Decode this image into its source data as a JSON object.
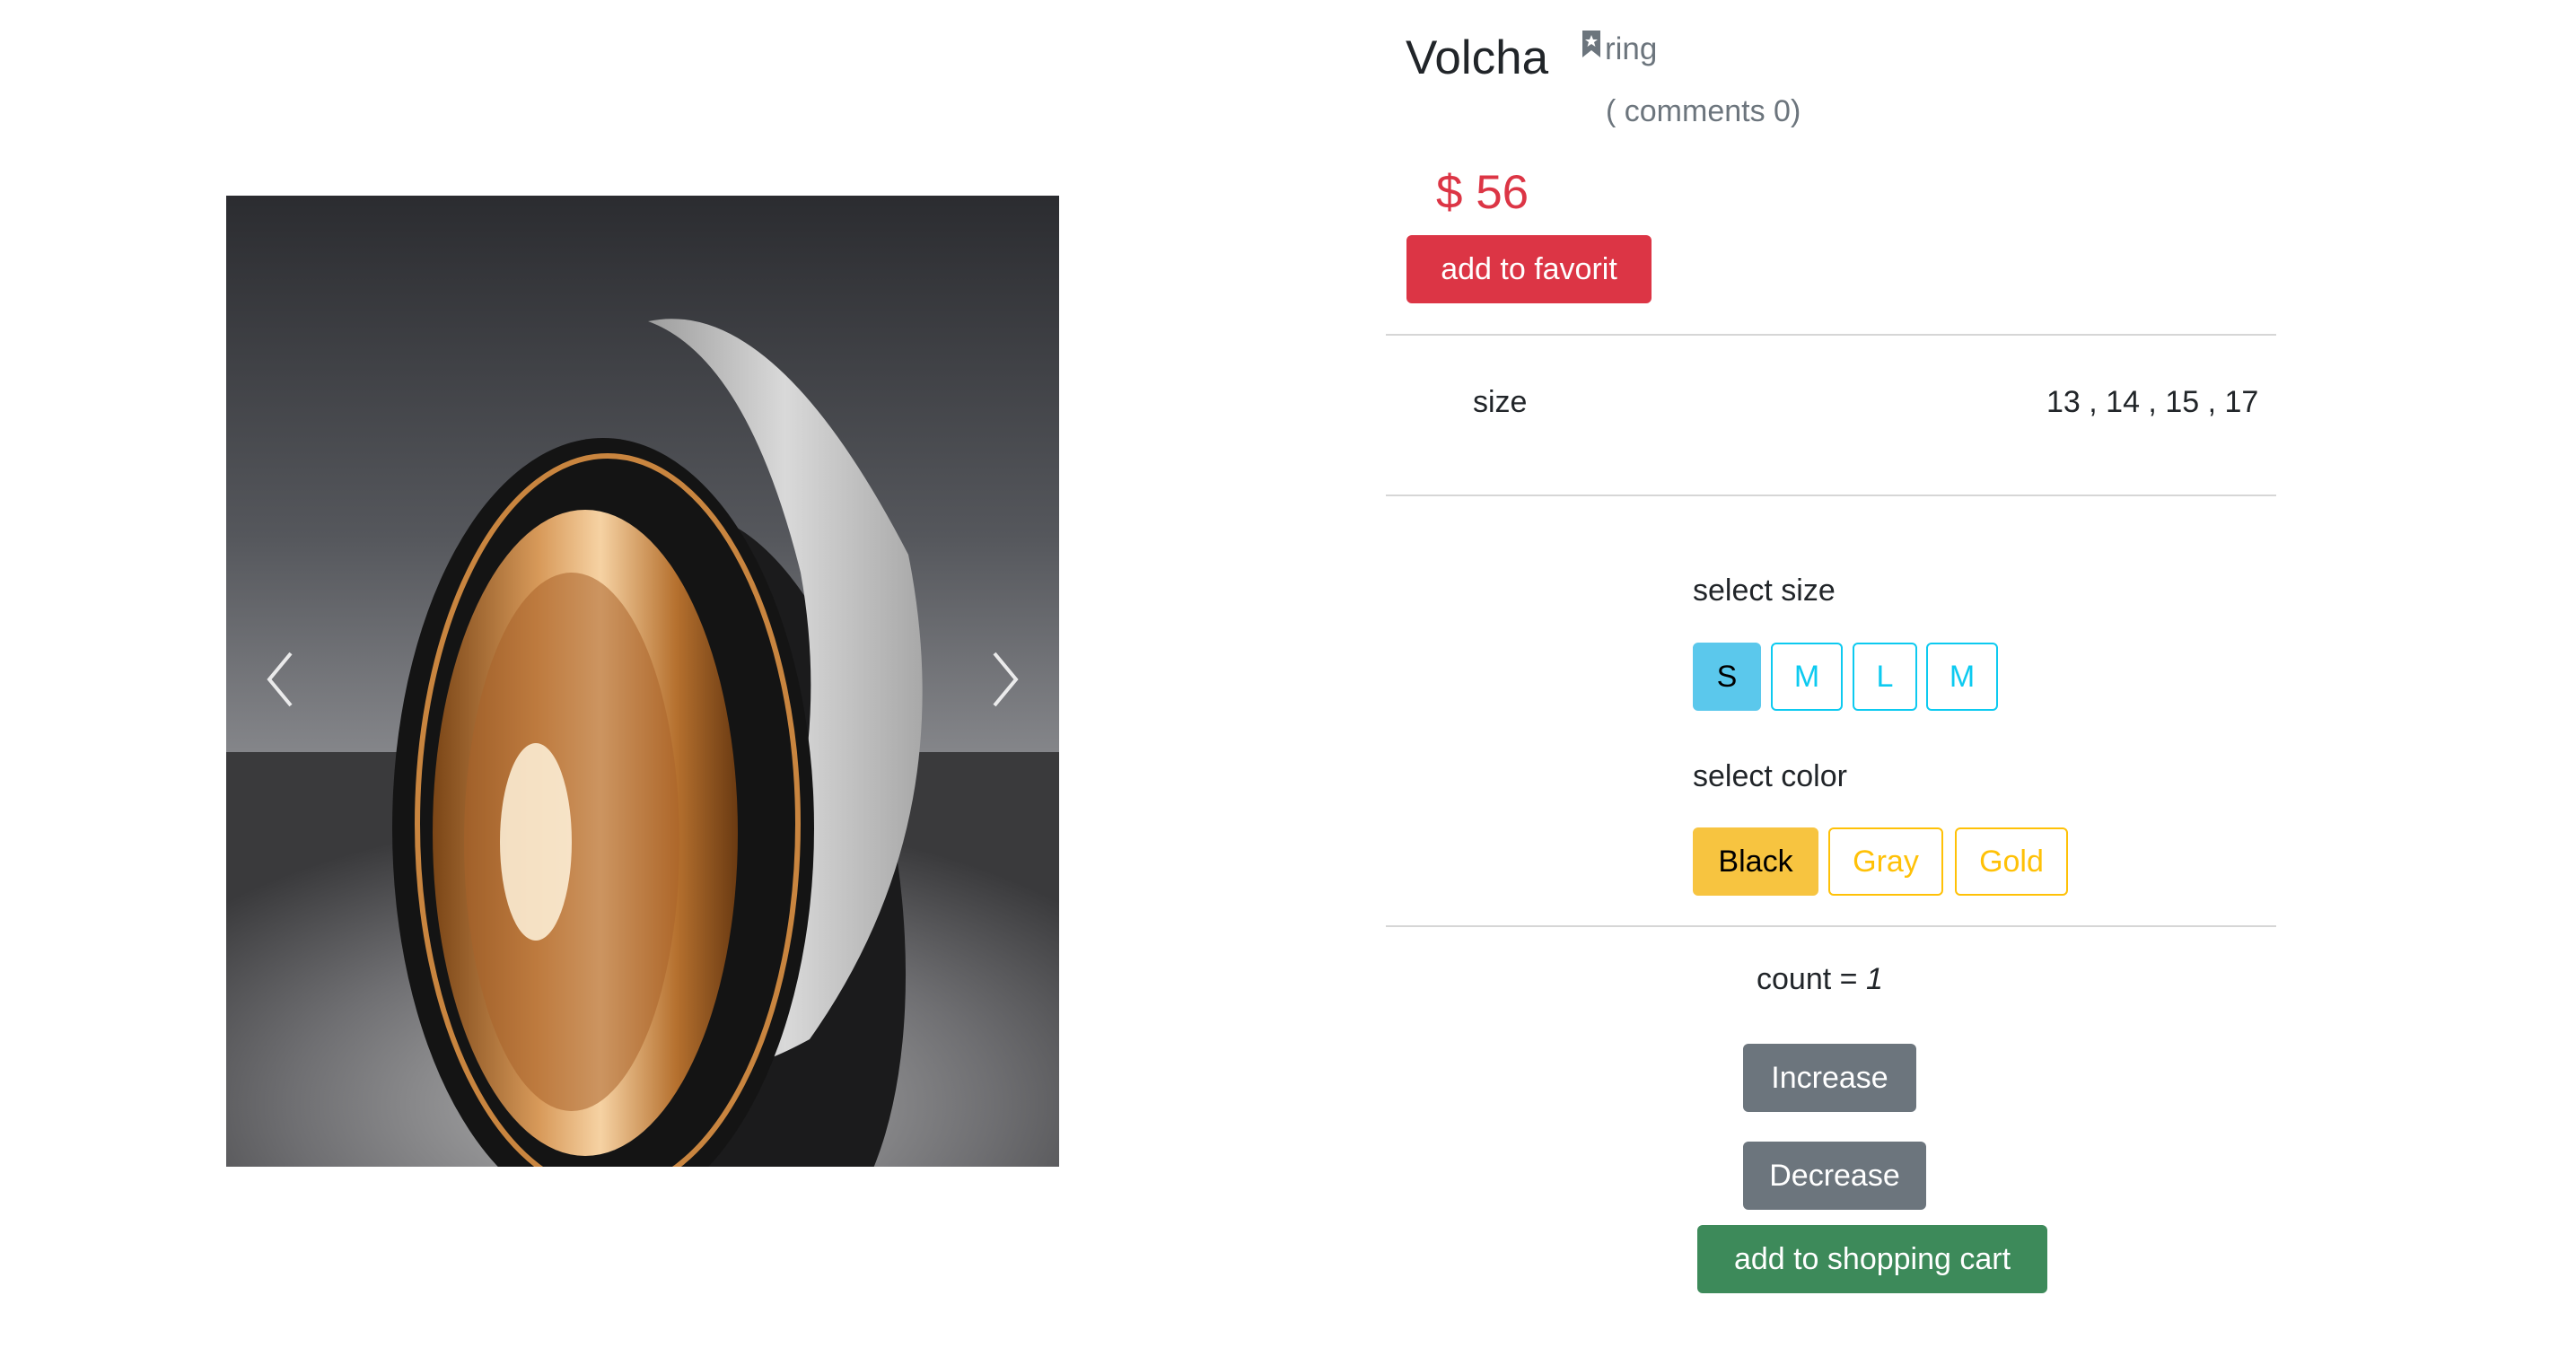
{
  "product": {
    "title": "Volcha",
    "category": "ring",
    "comments": "( comments 0)",
    "price": "$ 56",
    "favorite_label": "add to favorit"
  },
  "specs": {
    "size_label": "size",
    "size_values": "13 , 14 , 15 , 17"
  },
  "size_selector": {
    "label": "select size",
    "options": [
      "S",
      "M",
      "L",
      "M"
    ],
    "selected": "S"
  },
  "color_selector": {
    "label": "select color",
    "options": [
      "Black",
      "Gray",
      "Gold"
    ],
    "selected": "Black"
  },
  "quantity": {
    "label": "count =",
    "value": "1",
    "increase_label": "Increase",
    "decrease_label": "Decrease"
  },
  "cart": {
    "add_label": "add to shopping cart"
  },
  "carousel": {
    "prev_icon": "chevron-left-icon",
    "next_icon": "chevron-right-icon"
  },
  "colors": {
    "danger": "#dc3545",
    "info": "#0dcaf0",
    "warning": "#ffc107",
    "secondary": "#6c757d",
    "success": "#3d8a5a"
  }
}
